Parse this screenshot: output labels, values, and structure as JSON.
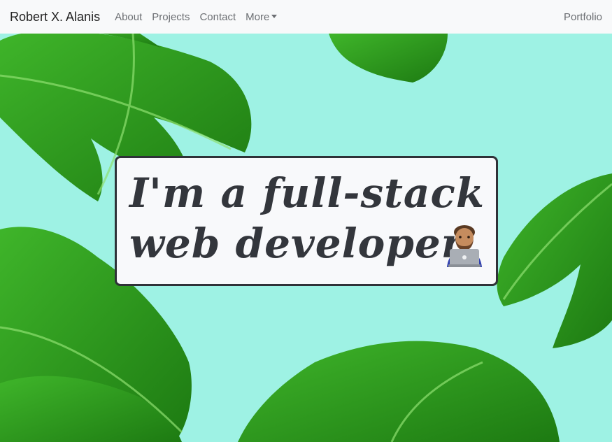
{
  "navbar": {
    "brand": "Robert X. Alanis",
    "links": [
      {
        "label": "About"
      },
      {
        "label": "Projects"
      },
      {
        "label": "Contact"
      },
      {
        "label": "More"
      }
    ],
    "right_link": "Portfolio"
  },
  "hero": {
    "headline_line1": "I'm a full-stack",
    "headline_line2": "web developer.",
    "emoji": "man-technologist-emoji",
    "background_color": "#9ef2e4",
    "leaf_color": "#2f9e1e"
  }
}
